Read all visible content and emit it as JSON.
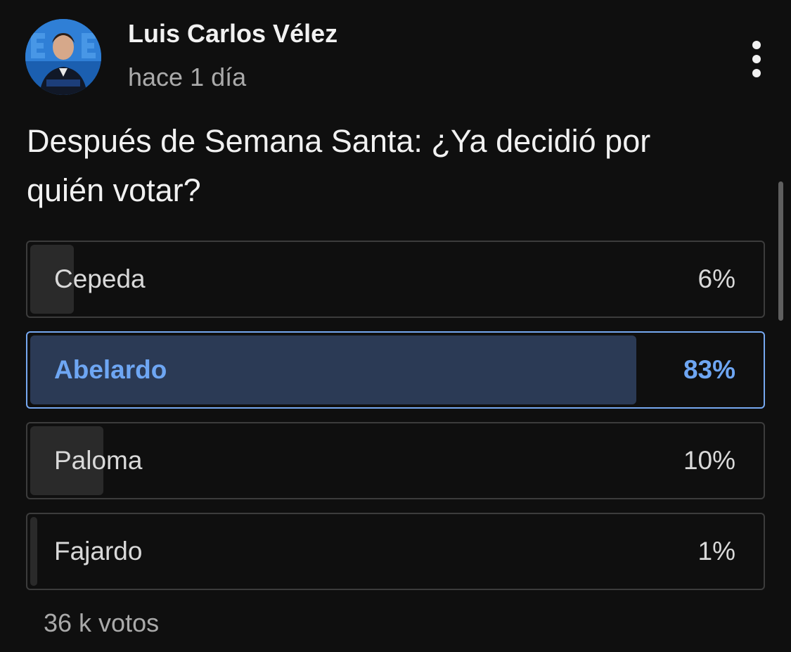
{
  "post": {
    "author": "Luis Carlos Vélez",
    "time": "hace 1 día",
    "avatar_icon": "avatar-photo",
    "menu_icon": "more-vertical-icon",
    "question": "Después de Semana Santa: ¿Ya decidió por quién votar?"
  },
  "poll": {
    "options": [
      {
        "label": "Cepeda",
        "percent_text": "6%",
        "percent": 6,
        "selected": false
      },
      {
        "label": "Abelardo",
        "percent_text": "83%",
        "percent": 83,
        "selected": true
      },
      {
        "label": "Paloma",
        "percent_text": "10%",
        "percent": 10,
        "selected": false
      },
      {
        "label": "Fajardo",
        "percent_text": "1%",
        "percent": 1,
        "selected": false
      }
    ],
    "votes": "36 k votos"
  },
  "colors": {
    "background": "#0f0f0f",
    "accent": "#6ea6f3",
    "selected_border": "#76a8f0",
    "selected_fill": "#2b3a55",
    "bar_fill": "#2a2a2a"
  }
}
